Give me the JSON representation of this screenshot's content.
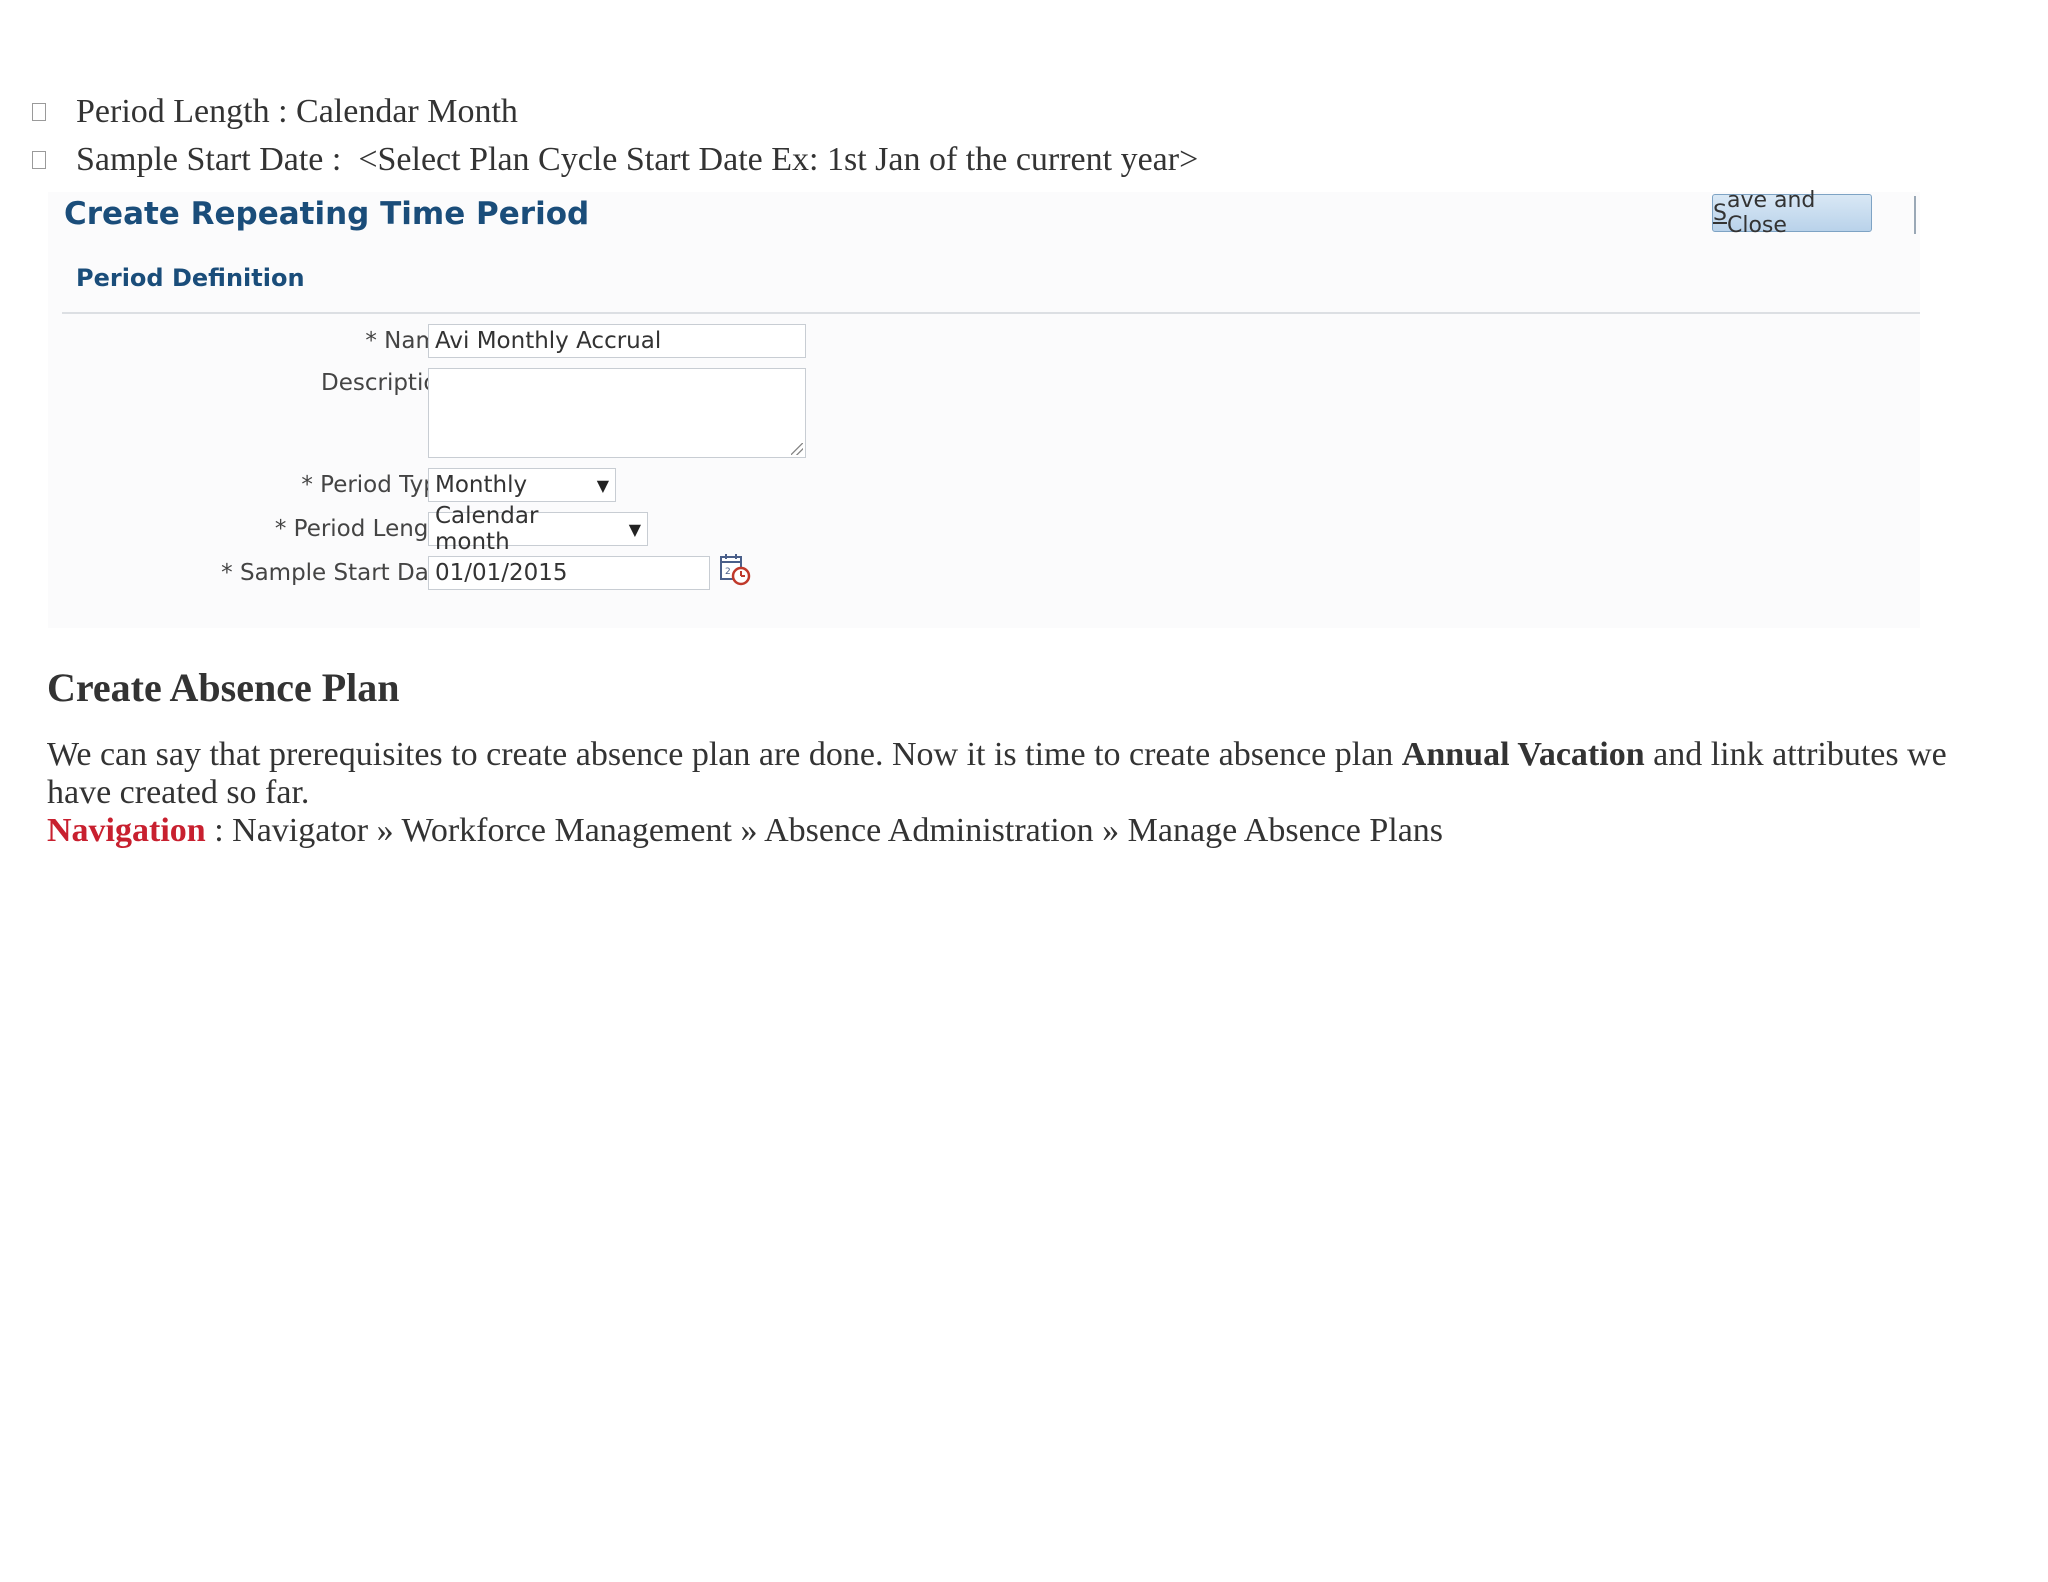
{
  "bullets": [
    {
      "label": "Period Length",
      "separator": ":",
      "value": "Calendar Month"
    },
    {
      "label": "Sample Start Date",
      "separator": ":",
      "value": "<Select Plan Cycle Start Date Ex: 1st Jan of the current year>"
    }
  ],
  "panel": {
    "title": "Create Repeating Time Period",
    "save_button": {
      "underlined": "S",
      "rest": "ave and Close"
    },
    "section_title": "Period Definition",
    "form": {
      "name": {
        "label": "* Name",
        "value": "Avi Monthly Accrual"
      },
      "description": {
        "label": "Description",
        "value": ""
      },
      "period_type": {
        "label": "* Period Type",
        "value": "Monthly"
      },
      "period_length": {
        "label": "* Period Length",
        "value": "Calendar month"
      },
      "sample_start_date": {
        "label": "* Sample Start Date",
        "value": "01/01/2015"
      }
    },
    "icons": {
      "select_arrow": "▼",
      "calendar": "calendar-icon"
    }
  },
  "section": {
    "heading": "Create Absence Plan",
    "paragraph": {
      "before": "We can say that prerequisites to create absence plan are done. Now it is time to create absence plan ",
      "bold": "Annual Vacation",
      "after": " and link attributes we have created so far."
    },
    "navigation": {
      "label": "Navigation",
      "path": " : Navigator » Workforce Management  » Absence Administration » Manage Absence Plans"
    }
  },
  "colors": {
    "nav_label": "#c8202f",
    "panel_title": "#1a4d7a",
    "button_bg": "#c9ddef"
  }
}
